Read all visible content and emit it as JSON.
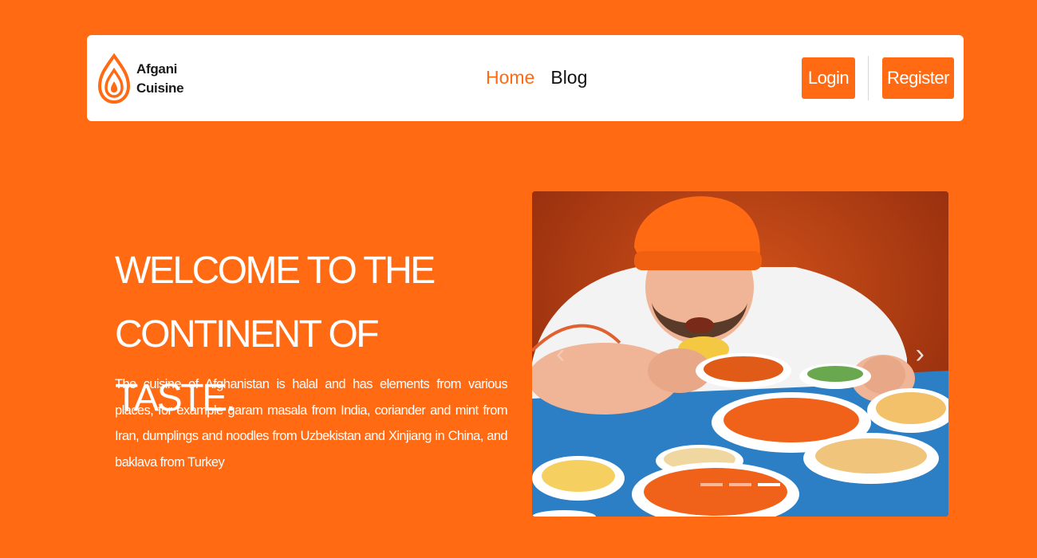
{
  "brand": {
    "line1": "Afgani",
    "line2": "Cuisine",
    "logo_icon": "flame-drop-icon",
    "accent_color": "#ff6a13"
  },
  "nav": {
    "links": [
      {
        "label": "Home",
        "active": true
      },
      {
        "label": "Blog",
        "active": false
      }
    ],
    "login_label": "Login",
    "register_label": "Register"
  },
  "hero": {
    "title_line1": "WELCOME TO THE",
    "title_line2": "CONTINENT OF TASTE.",
    "description": "The cuisine of Afghanistan is halal and has elements from various places, for example garam masala from India, coriander and mint from Iran, dumplings and noodles from Uzbekistan and Xinjiang in China, and baklava from Turkey"
  },
  "carousel": {
    "prev_icon": "chevron-left-icon",
    "next_icon": "chevron-right-icon",
    "prev_glyph": "‹",
    "next_glyph": "›",
    "slide_count": 3,
    "active_slide": 3
  },
  "colors": {
    "background": "#ff6a13",
    "navbar": "#ffffff",
    "text_dark": "#111111",
    "text_light": "#ffffff"
  }
}
